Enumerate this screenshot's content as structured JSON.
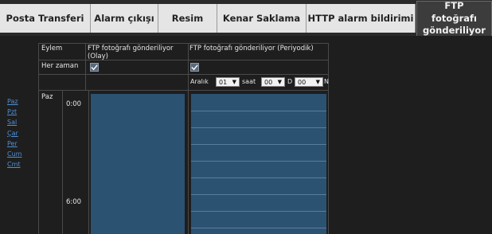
{
  "tabs": [
    {
      "label": "Posta Transferi"
    },
    {
      "label": "Alarm çıkışı"
    },
    {
      "label": "Resim"
    },
    {
      "label": "Kenar Saklama"
    },
    {
      "label": "HTTP alarm bildirimi"
    },
    {
      "label": "FTP fotoğrafı gönderiliyor",
      "active": true
    }
  ],
  "day_links": [
    "Paz",
    "Pzt",
    "Sal",
    "Çar",
    "Per",
    "Cum",
    "Cmt"
  ],
  "table": {
    "action_header": "Eylem",
    "col_event": "FTP fotoğrafı gönderiliyor (Olay)",
    "col_periodic": "FTP fotoğrafı gönderiliyor (Periyodik)",
    "always_label": "Her zaman",
    "always_event_checked": true,
    "always_periodic_checked": true,
    "interval_label": "Aralık",
    "interval_value": "01",
    "hour_label": "saat",
    "hour_value": "00",
    "minute_label": "D",
    "minute_value": "00",
    "second_label": "N",
    "day_label": "Paz",
    "times": [
      "0:00",
      "6:00"
    ]
  },
  "colors": {
    "schedule_fill": "#2c5272",
    "link": "#4d8fd6",
    "tab_bg": "#e5e5e5",
    "active_tab_bg": "#3c3c3c"
  }
}
